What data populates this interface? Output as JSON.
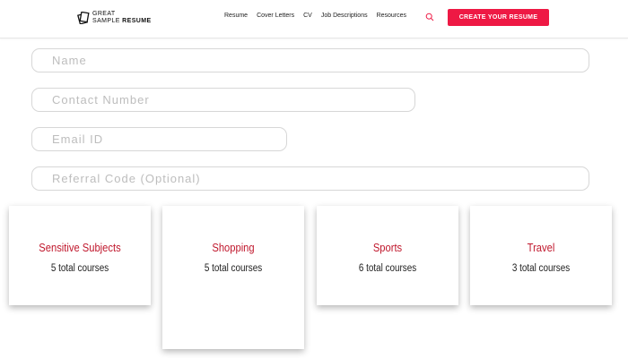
{
  "header": {
    "logo": {
      "line1": "GREAT",
      "line2a": "SAMPLE",
      "line2b": "RESUME"
    },
    "nav": [
      "Resume",
      "Cover Letters",
      "CV",
      "Job Descriptions",
      "Resources"
    ],
    "cta_label": "CREATE YOUR RESUME",
    "search_icon": "search-icon",
    "accent": "#ee1944"
  },
  "form": {
    "name_placeholder": "Name",
    "contact_placeholder": "Contact Number",
    "email_placeholder": "Email ID",
    "referral_placeholder": "Referral Code (Optional)"
  },
  "cards": [
    {
      "title": "Sensitive Subjects",
      "subtitle": "5 total courses"
    },
    {
      "title": "Shopping",
      "subtitle": "5 total courses"
    },
    {
      "title": "Sports",
      "subtitle": "6 total courses"
    },
    {
      "title": "Travel",
      "subtitle": "3 total courses"
    }
  ],
  "colors": {
    "card_title": "#c0182d"
  }
}
